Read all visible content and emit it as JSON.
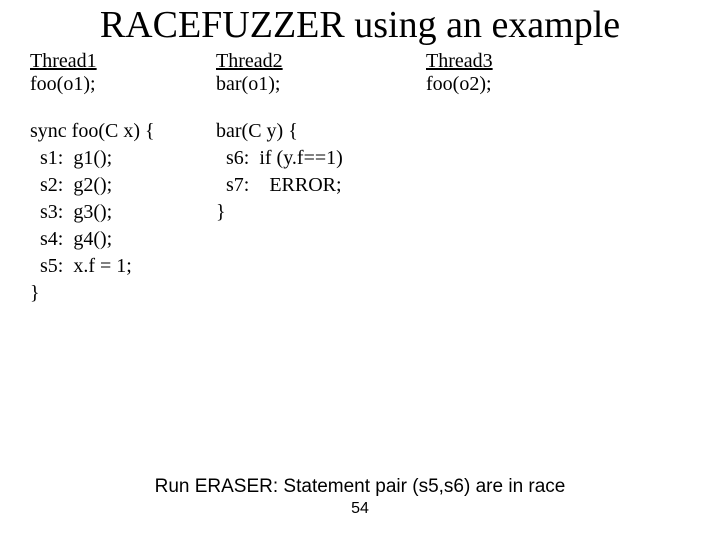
{
  "title": "RACEFUZZER using an example",
  "threads": {
    "t1": {
      "label": "Thread1",
      "call": "foo(o1);"
    },
    "t2": {
      "label": "Thread2",
      "call": "bar(o1);"
    },
    "t3": {
      "label": "Thread3",
      "call": "foo(o2);"
    }
  },
  "code": {
    "foo": "sync foo(C x) {\n  s1:  g1();\n  s2:  g2();\n  s3:  g3();\n  s4:  g4();\n  s5:  x.f = 1;\n}",
    "bar": "bar(C y) {\n  s6:  if (y.f==1)\n  s7:    ERROR;\n}"
  },
  "footer": "Run ERASER: Statement pair (s5,s6) are in race",
  "page": "54"
}
